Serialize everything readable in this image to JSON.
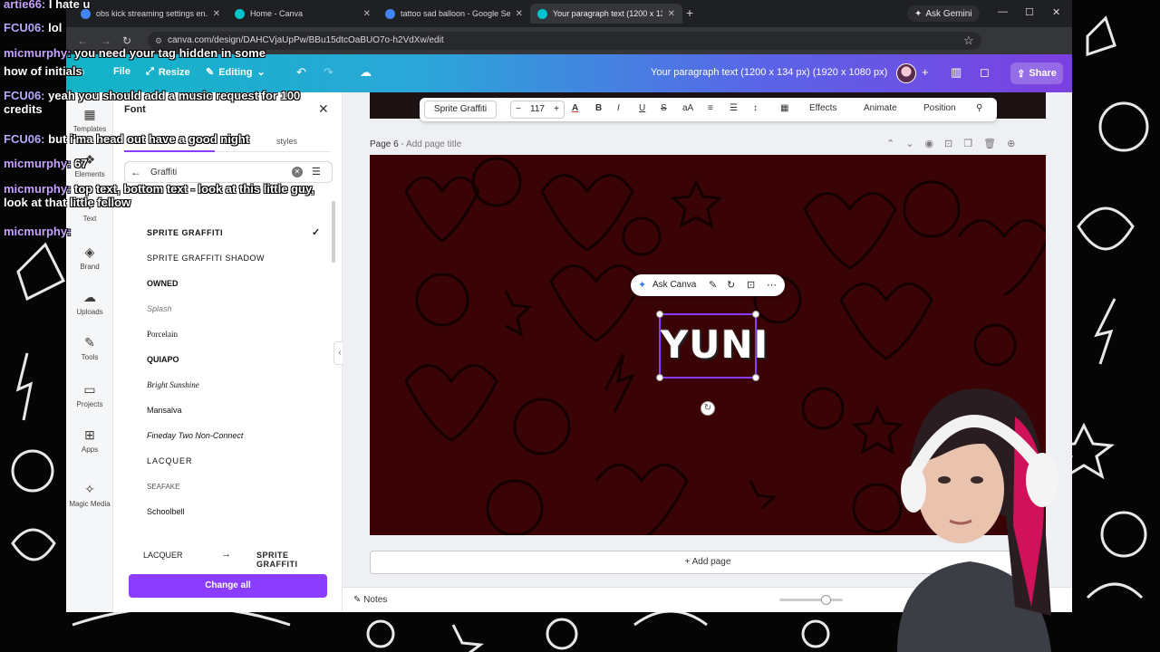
{
  "browser": {
    "tabs": [
      {
        "title": "obs kick streaming settings en...",
        "active": false
      },
      {
        "title": "Home - Canva",
        "active": false
      },
      {
        "title": "tattoo sad balloon - Google Se...",
        "active": false
      },
      {
        "title": "Your paragraph text (1200 x 13...",
        "active": true
      }
    ],
    "ask_gemini": "Ask Gemini",
    "url": "canva.com/design/DAHCVjaUpPw/BBu15dtcOaBUO7o-h2VdXw/edit"
  },
  "canva_header": {
    "file": "File",
    "resize": "Resize",
    "editing": "Editing",
    "doc_title": "Your paragraph text (1200 x 134 px) (1920 x 1080 px)",
    "share": "Share"
  },
  "rail": [
    {
      "label": "Templates",
      "icon": "templates-icon"
    },
    {
      "label": "Elements",
      "icon": "elements-icon"
    },
    {
      "label": "Text",
      "icon": "text-icon"
    },
    {
      "label": "Brand",
      "icon": "brand-icon"
    },
    {
      "label": "Uploads",
      "icon": "uploads-icon"
    },
    {
      "label": "Tools",
      "icon": "tools-icon"
    },
    {
      "label": "Projects",
      "icon": "projects-icon"
    },
    {
      "label": "Apps",
      "icon": "apps-icon"
    },
    {
      "label": "Magic Media",
      "icon": "magic-media-icon"
    }
  ],
  "font_panel": {
    "title": "Font",
    "styles_tab": "styles",
    "search_value": "Graffiti",
    "fonts": [
      {
        "name": "SPRITE GRAFFITI",
        "selected": true
      },
      {
        "name": "SPRITE GRAFFITI SHADOW",
        "selected": false
      },
      {
        "name": "OWNED",
        "selected": false
      },
      {
        "name": "Splash",
        "selected": false
      },
      {
        "name": "Porcelain",
        "selected": false
      },
      {
        "name": "QUIAPO",
        "selected": false
      },
      {
        "name": "Bright Sunshine",
        "selected": false
      },
      {
        "name": "Mansalva",
        "selected": false
      },
      {
        "name": "Fineday Two Non-Connect",
        "selected": false
      },
      {
        "name": "LACQUER",
        "selected": false
      },
      {
        "name": "SEAFAKE",
        "selected": false
      },
      {
        "name": "Schoolbell",
        "selected": false
      }
    ],
    "swap_from": "LACQUER",
    "swap_to": "SPRITE GRAFFITI",
    "change_all": "Change all"
  },
  "toolbar": {
    "font": "Sprite Graffiti",
    "size": "117",
    "effects": "Effects",
    "animate": "Animate",
    "position": "Position"
  },
  "editor": {
    "page_label": "Page 6",
    "page_title_placeholder": "- Add page title",
    "ask_canva": "Ask Canva",
    "canvas_text": "YUNI",
    "add_page": "+ Add page",
    "notes": "Notes",
    "page_color": "#3a0306",
    "accent": "#8b3dff"
  },
  "chat": [
    {
      "user": "artie66:",
      "msg": "I hate u"
    },
    {
      "user": "FCU06:",
      "msg": "lol"
    },
    {
      "user": "micmurphy:",
      "msg": "you need your tag hidden in some"
    },
    {
      "user": "",
      "msg": "how of initials"
    },
    {
      "user": "FCU06:",
      "msg": "yeah you should add a music request for 100 credits"
    },
    {
      "user": "FCU06:",
      "msg": "but i'ma head out have a good night"
    },
    {
      "user": "micmurphy:",
      "msg": "67"
    },
    {
      "user": "micmurphy:",
      "msg": "top text, bottom text - look at this little guy, look at that little fellow"
    },
    {
      "user": "micmurphy:",
      "msg": ""
    }
  ]
}
